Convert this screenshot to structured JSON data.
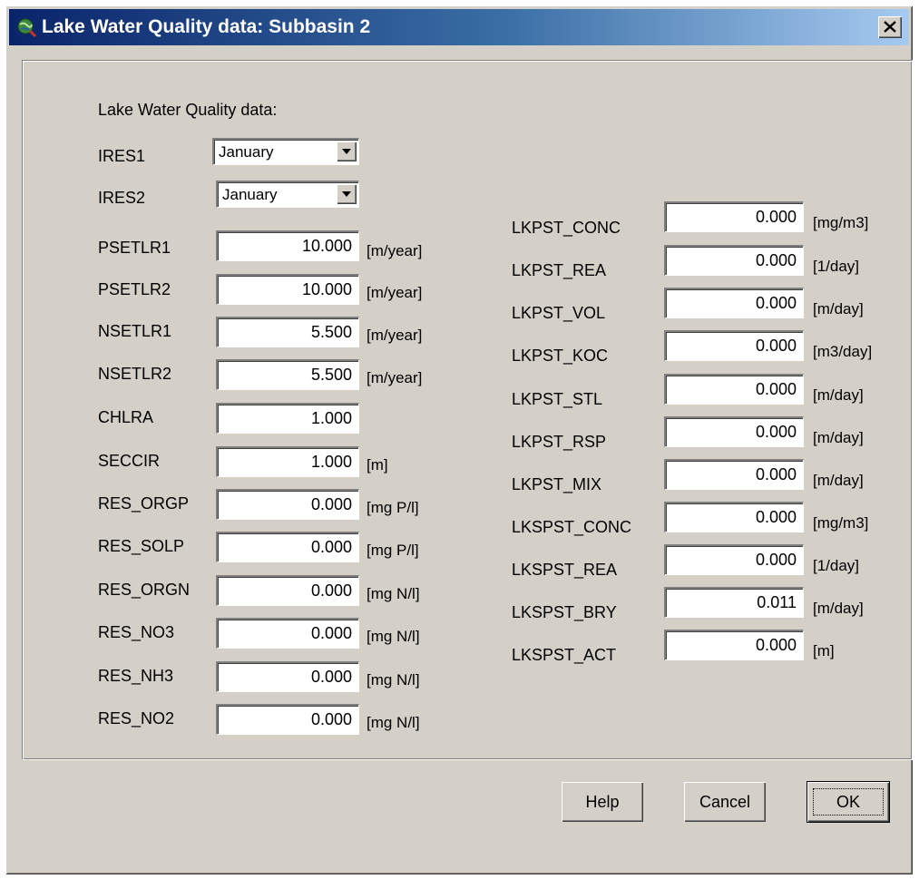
{
  "window": {
    "title": "Lake Water Quality data: Subbasin 2",
    "icon": "globe-search-icon",
    "close_label": "close"
  },
  "panel": {
    "heading": "Lake Water Quality data:"
  },
  "left": {
    "combos": [
      {
        "label": "IRES1",
        "value": "January"
      },
      {
        "label": "IRES2",
        "value": "January"
      }
    ],
    "fields": [
      {
        "label": "PSETLR1",
        "value": "10.000",
        "unit": "[m/year]"
      },
      {
        "label": "PSETLR2",
        "value": "10.000",
        "unit": "[m/year]"
      },
      {
        "label": "NSETLR1",
        "value": "5.500",
        "unit": "[m/year]"
      },
      {
        "label": "NSETLR2",
        "value": "5.500",
        "unit": "[m/year]"
      },
      {
        "label": "CHLRA",
        "value": "1.000",
        "unit": ""
      },
      {
        "label": "SECCIR",
        "value": "1.000",
        "unit": "[m]"
      },
      {
        "label": "RES_ORGP",
        "value": "0.000",
        "unit": "[mg P/l]"
      },
      {
        "label": "RES_SOLP",
        "value": "0.000",
        "unit": "[mg P/l]"
      },
      {
        "label": "RES_ORGN",
        "value": "0.000",
        "unit": "[mg N/l]"
      },
      {
        "label": "RES_NO3",
        "value": "0.000",
        "unit": "[mg N/l]"
      },
      {
        "label": "RES_NH3",
        "value": "0.000",
        "unit": "[mg N/l]"
      },
      {
        "label": "RES_NO2",
        "value": "0.000",
        "unit": "[mg N/l]"
      }
    ]
  },
  "right": {
    "fields": [
      {
        "label": "LKPST_CONC",
        "value": "0.000",
        "unit": "[mg/m3]"
      },
      {
        "label": "LKPST_REA",
        "value": "0.000",
        "unit": "[1/day]"
      },
      {
        "label": "LKPST_VOL",
        "value": "0.000",
        "unit": "[m/day]"
      },
      {
        "label": "LKPST_KOC",
        "value": "0.000",
        "unit": "[m3/day]"
      },
      {
        "label": "LKPST_STL",
        "value": "0.000",
        "unit": "[m/day]"
      },
      {
        "label": "LKPST_RSP",
        "value": "0.000",
        "unit": "[m/day]"
      },
      {
        "label": "LKPST_MIX",
        "value": "0.000",
        "unit": "[m/day]"
      },
      {
        "label": "LKSPST_CONC",
        "value": "0.000",
        "unit": "[mg/m3]"
      },
      {
        "label": "LKSPST_REA",
        "value": "0.000",
        "unit": "[1/day]"
      },
      {
        "label": "LKSPST_BRY",
        "value": "0.011",
        "unit": "[m/day]"
      },
      {
        "label": "LKSPST_ACT",
        "value": "0.000",
        "unit": "[m]"
      }
    ]
  },
  "buttons": {
    "help": "Help",
    "cancel": "Cancel",
    "ok": "OK"
  }
}
